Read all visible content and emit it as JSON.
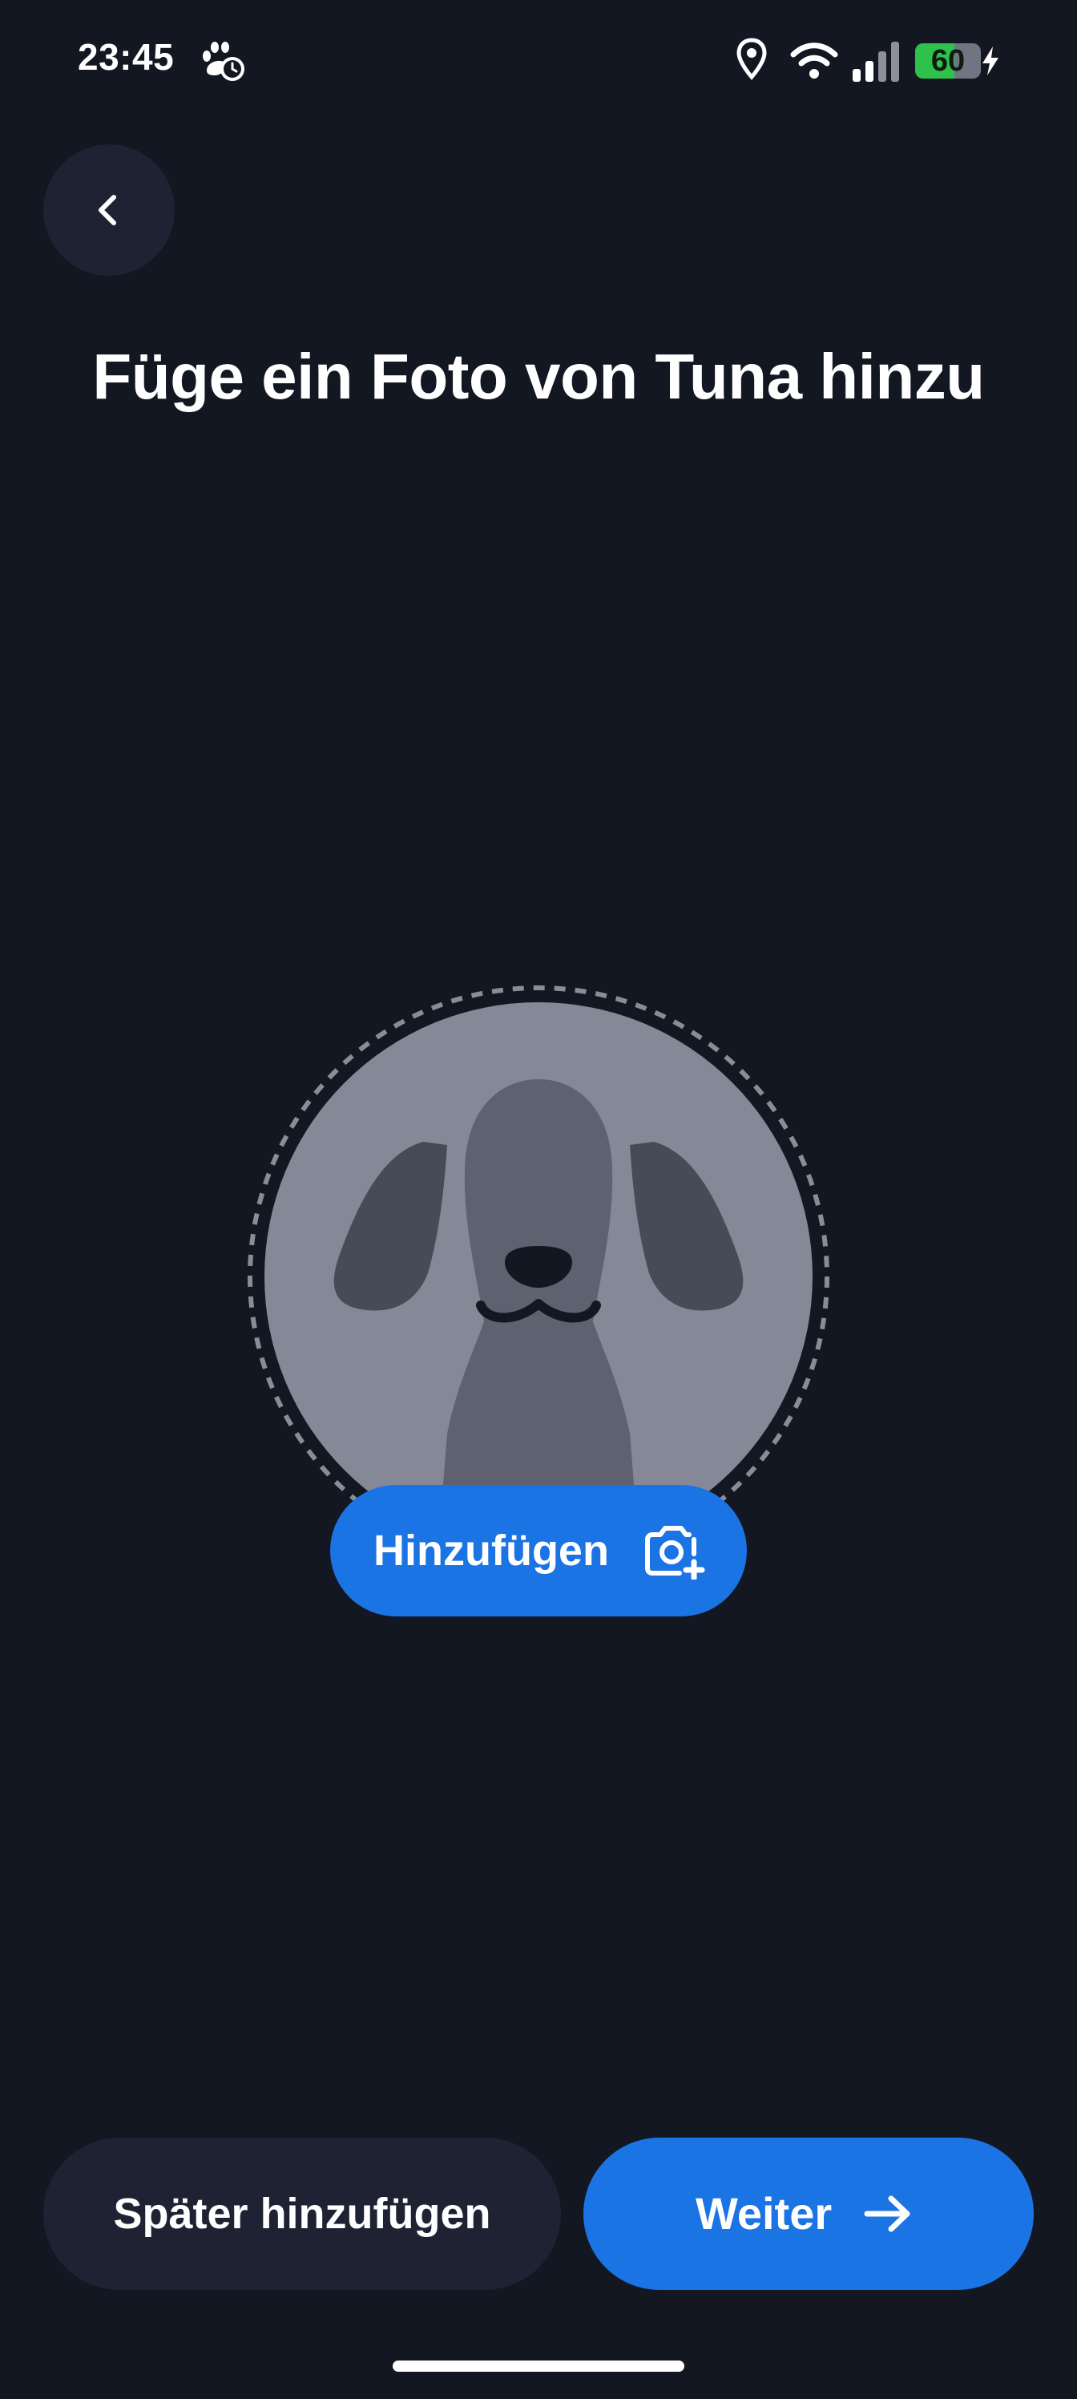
{
  "status_bar": {
    "time": "23:45",
    "battery_level": "60",
    "battery_percent": 60,
    "left_icon": "paw-clock-icon",
    "right_icons": [
      "location-pin-icon",
      "wifi-icon",
      "cellular-signal-icon",
      "battery-icon",
      "charging-bolt-icon"
    ]
  },
  "navigation": {
    "back_icon": "chevron-left-icon"
  },
  "page": {
    "title": "Füge ein Foto von Tuna hinzu"
  },
  "photo": {
    "placeholder_icon": "dog-silhouette-icon",
    "add_button_label": "Hinzufügen",
    "add_button_icon": "camera-plus-icon"
  },
  "actions": {
    "later_label": "Später hinzufügen",
    "next_label": "Weiter",
    "next_icon": "arrow-right-icon"
  },
  "colors": {
    "background": "#131722",
    "primary": "#1b74e4",
    "secondary_button": "#1e2232",
    "avatar_circle": "#858896",
    "dog_body": "#5d6170",
    "dog_ears": "#474b58",
    "battery_green": "#2fc24b"
  }
}
